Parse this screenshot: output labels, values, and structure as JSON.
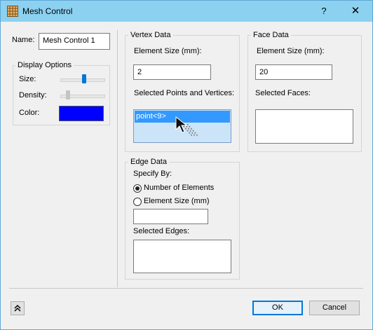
{
  "window": {
    "title": "Mesh Control",
    "help_glyph": "?",
    "close_glyph": "✕"
  },
  "name_label": "Name:",
  "name_value": "Mesh Control 1",
  "display_options": {
    "title": "Display Options",
    "size_label": "Size:",
    "density_label": "Density:",
    "color_label": "Color:",
    "color_value": "#0000ff",
    "size_level_pct": 55,
    "density_level_pct": 15
  },
  "vertex_data": {
    "title": "Vertex Data",
    "element_size_label": "Element Size (mm):",
    "element_size_value": "2",
    "selected_label": "Selected Points and Vertices:",
    "selected_items": [
      "point<9>"
    ]
  },
  "face_data": {
    "title": "Face Data",
    "element_size_label": "Element Size (mm):",
    "element_size_value": "20",
    "selected_label": "Selected Faces:"
  },
  "edge_data": {
    "title": "Edge Data",
    "specify_by_label": "Specify By:",
    "option_number": "Number of Elements",
    "option_size": "Element Size (mm)",
    "element_size_value": "",
    "selected_label": "Selected Edges:"
  },
  "footer": {
    "ok_label": "OK",
    "cancel_label": "Cancel",
    "expand_glyph": "⌃"
  },
  "colors": {
    "titlebar": "#8cd1f0",
    "selection": "#3399ff",
    "listbox_selected_bg": "#cce4f7"
  }
}
